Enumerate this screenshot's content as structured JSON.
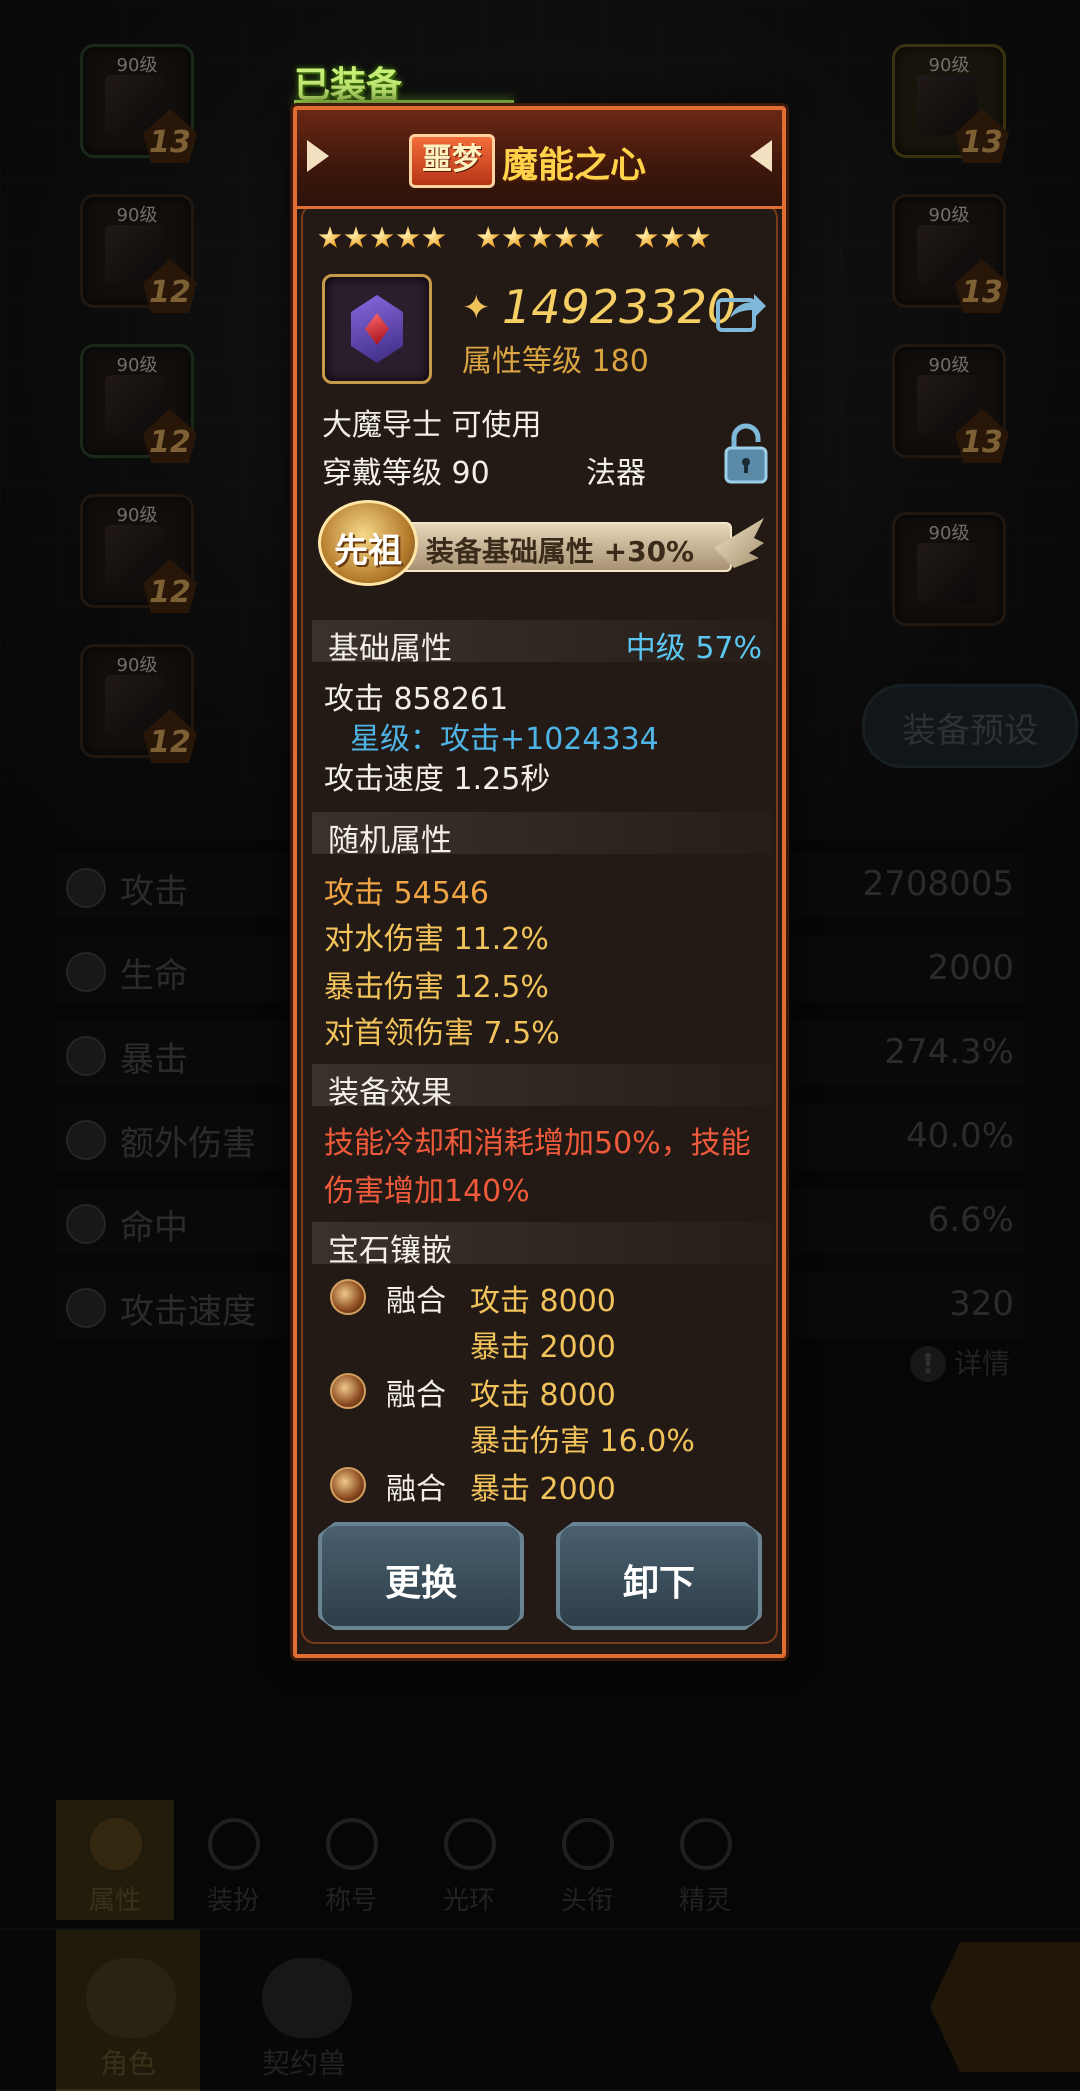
{
  "background": {
    "slot_level_label": "90级",
    "left_slots": [
      "13",
      "12",
      "12",
      "12",
      "12"
    ],
    "right_slots": [
      "13",
      "13",
      "13",
      ""
    ],
    "preset_button": "装备预设",
    "stats": [
      {
        "name": "攻击",
        "value": "2708005"
      },
      {
        "name": "生命",
        "value": "2000"
      },
      {
        "name": "暴击",
        "value": "274.3%"
      },
      {
        "name": "额外伤害",
        "value": "40.0%"
      },
      {
        "name": "命中",
        "value": "6.6%"
      },
      {
        "name": "攻击速度",
        "value": "320"
      }
    ],
    "details_link": "详情",
    "bottom_tabs": [
      "属性",
      "装扮",
      "称号",
      "光环",
      "头衔",
      "精灵"
    ],
    "footer_tabs": [
      "角色",
      "契约兽"
    ]
  },
  "popup": {
    "equipped_label": "已装备",
    "rarity": "噩梦",
    "item_name": "魔能之心",
    "stars_groups": [
      5,
      5,
      3
    ],
    "combat_power": "14923320",
    "attr_level": "属性等级 180",
    "usable_class": "大魔导士 可使用",
    "wear_level": "穿戴等级 90",
    "item_type": "法器",
    "ancestor_badge": "先祖",
    "ancestor_bonus": "装备基础属性 +30%",
    "base": {
      "title": "基础属性",
      "grade": "中级  57%",
      "attack": "攻击  858261",
      "star_bonus": "星级：攻击+1024334",
      "attack_speed": "攻击速度  1.25秒"
    },
    "random": {
      "title": "随机属性",
      "lines": [
        "攻击    54546",
        "对水伤害    11.2%",
        "暴击伤害    12.5%",
        "对首领伤害    7.5%"
      ]
    },
    "effect": {
      "title": "装备效果",
      "line1": "技能冷却和消耗增加50%，技能",
      "line2": "伤害增加140%"
    },
    "gems": {
      "title": "宝石镶嵌",
      "items": [
        {
          "type": "融合",
          "stats": [
            "攻击 8000",
            "暴击 2000"
          ]
        },
        {
          "type": "融合",
          "stats": [
            "攻击 8000",
            "暴击伤害 16.0%"
          ]
        },
        {
          "type": "融合",
          "stats": [
            "暴击 2000"
          ]
        }
      ]
    },
    "buttons": {
      "replace": "更换",
      "unequip": "卸下"
    }
  },
  "colors": {
    "accent": "#e06e33",
    "gold": "#f2c35a",
    "blue": "#4fb4e6",
    "red": "#ef5a3a"
  }
}
